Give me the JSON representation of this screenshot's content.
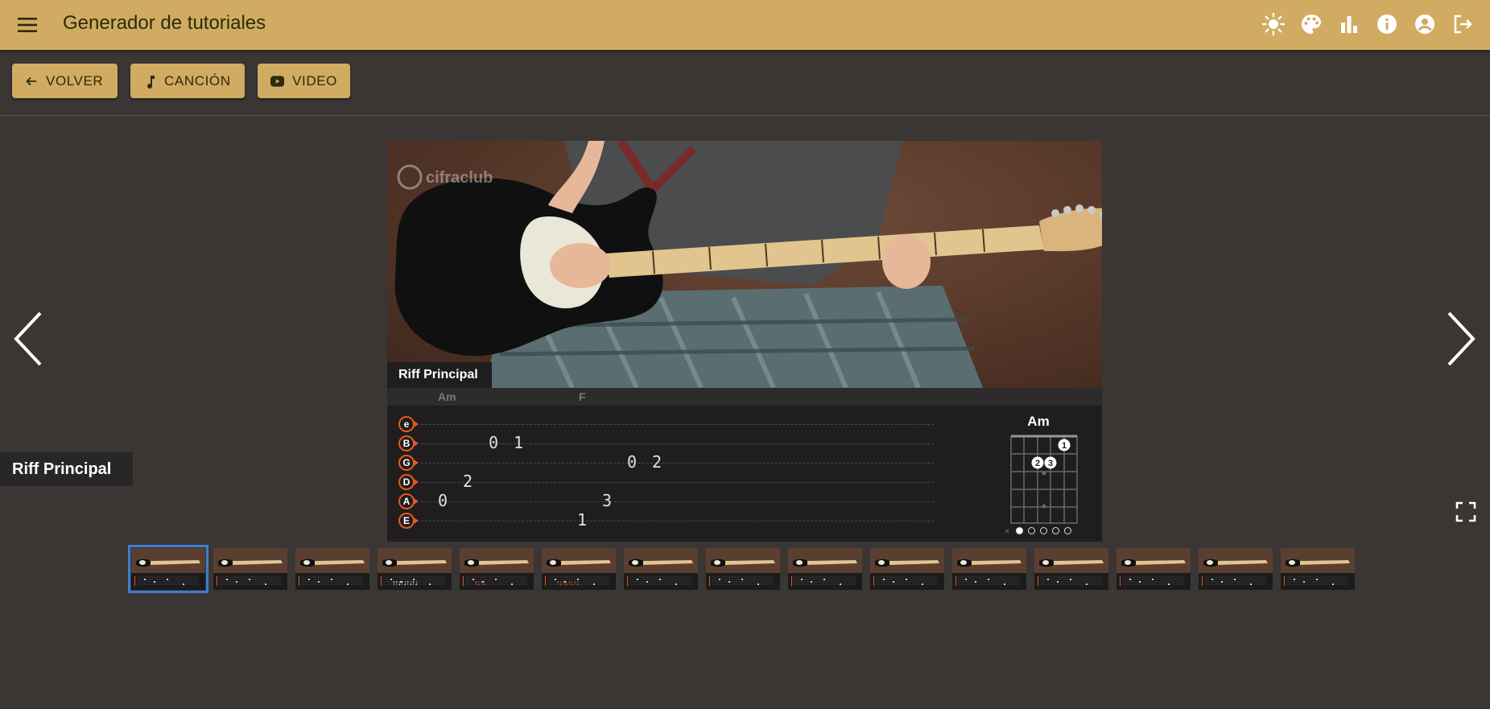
{
  "header": {
    "title": "Generador de tutoriales",
    "icons": [
      "menu-icon",
      "brightness-icon",
      "palette-icon",
      "bar-chart-icon",
      "info-icon",
      "account-circle-icon",
      "logout-icon"
    ]
  },
  "toolbar": {
    "back_label": "VOLVER",
    "song_label": "CANCIÓN",
    "video_label": "VIDEO"
  },
  "slide": {
    "caption": "Riff Principal",
    "part_label": "Riff Principal",
    "chords_top": [
      "Am",
      "F"
    ],
    "strings": [
      "e",
      "B",
      "G",
      "D",
      "A",
      "E"
    ],
    "frets": [
      {
        "string": "B",
        "text": "0"
      },
      {
        "string": "B",
        "text": "1"
      },
      {
        "string": "G",
        "text": "0"
      },
      {
        "string": "G",
        "text": "2"
      },
      {
        "string": "D",
        "text": "2"
      },
      {
        "string": "A",
        "text": "0"
      },
      {
        "string": "A",
        "text": "3"
      },
      {
        "string": "E",
        "text": "1"
      }
    ],
    "progress_dots": 15,
    "progress_active": 1,
    "chord_diagram": {
      "name": "Am",
      "fingers": [
        "1",
        "2",
        "3"
      ],
      "muted_symbol": "×",
      "page_dots": 5,
      "page_active": 1
    }
  },
  "thumbnails": {
    "count": 15,
    "active_index": 1,
    "arrow_labels": [
      "↑↑↓↑↓↑↓↑↓",
      "↑↓↑↓",
      "↑↓↑↓↑↓↑↓",
      ""
    ]
  },
  "colors": {
    "appbar": "#d0ab61",
    "background": "#3a3634",
    "accent_orange": "#e35a1f",
    "thumb_active": "#3a7fd0"
  }
}
